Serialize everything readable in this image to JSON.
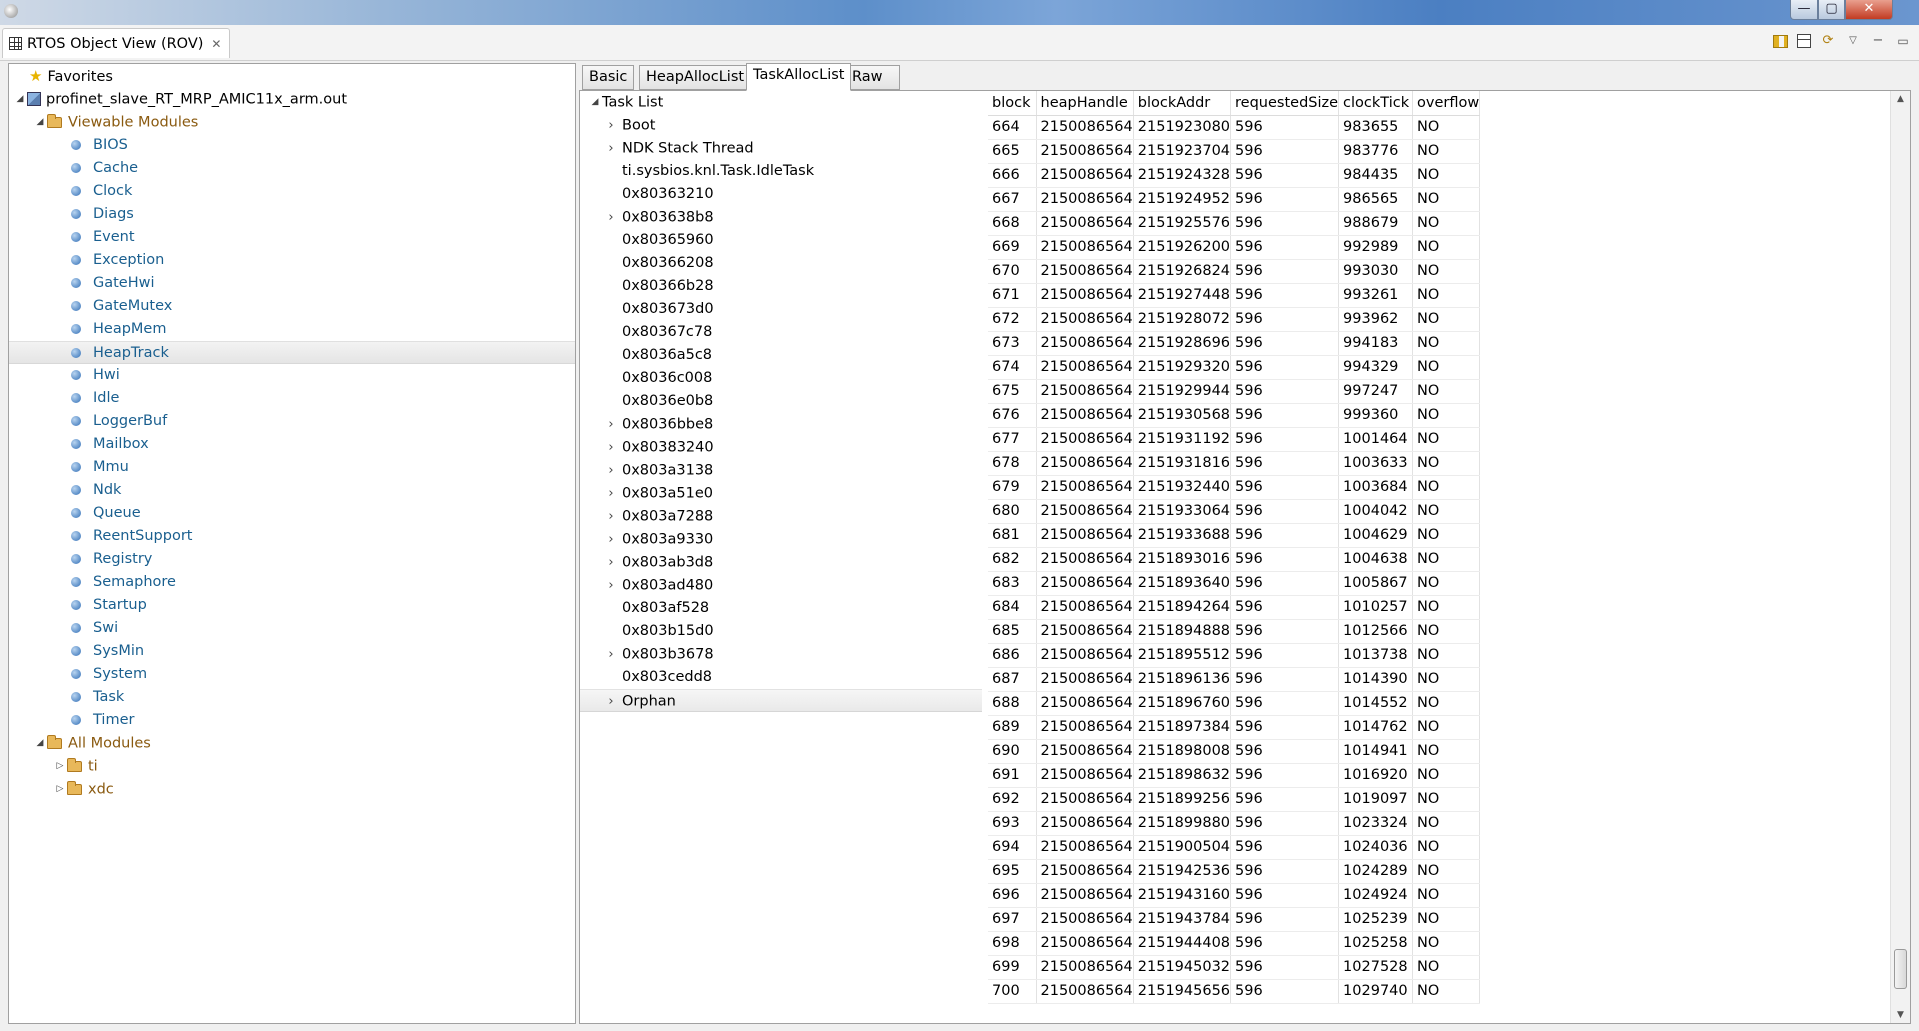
{
  "view": {
    "title": "RTOS Object View (ROV)",
    "close_glyph": "✕"
  },
  "window_buttons": {
    "minimize": "—",
    "maximize": "▢",
    "close": "✕"
  },
  "module_tree": {
    "favorites": "Favorites",
    "root": "profinet_slave_RT_MRP_AMIC11x_arm.out",
    "viewable_label": "Viewable Modules",
    "viewable": [
      "BIOS",
      "Cache",
      "Clock",
      "Diags",
      "Event",
      "Exception",
      "GateHwi",
      "GateMutex",
      "HeapMem",
      "HeapTrack",
      "Hwi",
      "Idle",
      "LoggerBuf",
      "Mailbox",
      "Mmu",
      "Ndk",
      "Queue",
      "ReentSupport",
      "Registry",
      "Semaphore",
      "Startup",
      "Swi",
      "SysMin",
      "System",
      "Task",
      "Timer"
    ],
    "selected": "HeapTrack",
    "all_label": "All Modules",
    "all": [
      "ti",
      "xdc"
    ]
  },
  "tabs": [
    {
      "label": "Basic",
      "active": false
    },
    {
      "label": "HeapAllocList",
      "active": false
    },
    {
      "label": "TaskAllocList",
      "active": true
    },
    {
      "label": "Raw",
      "active": false
    }
  ],
  "task_tree": {
    "root": "Task List",
    "items": [
      {
        "label": "Boot",
        "expandable": true
      },
      {
        "label": "NDK Stack Thread",
        "expandable": true
      },
      {
        "label": "ti.sysbios.knl.Task.IdleTask",
        "expandable": false
      },
      {
        "label": "0x80363210",
        "expandable": false
      },
      {
        "label": "0x803638b8",
        "expandable": true
      },
      {
        "label": "0x80365960",
        "expandable": false
      },
      {
        "label": "0x80366208",
        "expandable": false
      },
      {
        "label": "0x80366b28",
        "expandable": false
      },
      {
        "label": "0x803673d0",
        "expandable": false
      },
      {
        "label": "0x80367c78",
        "expandable": false
      },
      {
        "label": "0x8036a5c8",
        "expandable": false
      },
      {
        "label": "0x8036c008",
        "expandable": false
      },
      {
        "label": "0x8036e0b8",
        "expandable": false
      },
      {
        "label": "0x8036bbe8",
        "expandable": true
      },
      {
        "label": "0x80383240",
        "expandable": true
      },
      {
        "label": "0x803a3138",
        "expandable": true
      },
      {
        "label": "0x803a51e0",
        "expandable": true
      },
      {
        "label": "0x803a7288",
        "expandable": true
      },
      {
        "label": "0x803a9330",
        "expandable": true
      },
      {
        "label": "0x803ab3d8",
        "expandable": true
      },
      {
        "label": "0x803ad480",
        "expandable": true
      },
      {
        "label": "0x803af528",
        "expandable": false
      },
      {
        "label": "0x803b15d0",
        "expandable": false
      },
      {
        "label": "0x803b3678",
        "expandable": true
      },
      {
        "label": "0x803cedd8",
        "expandable": false
      },
      {
        "label": "Orphan",
        "expandable": true
      }
    ]
  },
  "alloc_table": {
    "columns": [
      "block",
      "heapHandle",
      "blockAddr",
      "requestedSize",
      "clockTick",
      "overflow"
    ],
    "rows": [
      [
        "664",
        "2150086564",
        "2151923080",
        "596",
        "983655",
        "NO"
      ],
      [
        "665",
        "2150086564",
        "2151923704",
        "596",
        "983776",
        "NO"
      ],
      [
        "666",
        "2150086564",
        "2151924328",
        "596",
        "984435",
        "NO"
      ],
      [
        "667",
        "2150086564",
        "2151924952",
        "596",
        "986565",
        "NO"
      ],
      [
        "668",
        "2150086564",
        "2151925576",
        "596",
        "988679",
        "NO"
      ],
      [
        "669",
        "2150086564",
        "2151926200",
        "596",
        "992989",
        "NO"
      ],
      [
        "670",
        "2150086564",
        "2151926824",
        "596",
        "993030",
        "NO"
      ],
      [
        "671",
        "2150086564",
        "2151927448",
        "596",
        "993261",
        "NO"
      ],
      [
        "672",
        "2150086564",
        "2151928072",
        "596",
        "993962",
        "NO"
      ],
      [
        "673",
        "2150086564",
        "2151928696",
        "596",
        "994183",
        "NO"
      ],
      [
        "674",
        "2150086564",
        "2151929320",
        "596",
        "994329",
        "NO"
      ],
      [
        "675",
        "2150086564",
        "2151929944",
        "596",
        "997247",
        "NO"
      ],
      [
        "676",
        "2150086564",
        "2151930568",
        "596",
        "999360",
        "NO"
      ],
      [
        "677",
        "2150086564",
        "2151931192",
        "596",
        "1001464",
        "NO"
      ],
      [
        "678",
        "2150086564",
        "2151931816",
        "596",
        "1003633",
        "NO"
      ],
      [
        "679",
        "2150086564",
        "2151932440",
        "596",
        "1003684",
        "NO"
      ],
      [
        "680",
        "2150086564",
        "2151933064",
        "596",
        "1004042",
        "NO"
      ],
      [
        "681",
        "2150086564",
        "2151933688",
        "596",
        "1004629",
        "NO"
      ],
      [
        "682",
        "2150086564",
        "2151893016",
        "596",
        "1004638",
        "NO"
      ],
      [
        "683",
        "2150086564",
        "2151893640",
        "596",
        "1005867",
        "NO"
      ],
      [
        "684",
        "2150086564",
        "2151894264",
        "596",
        "1010257",
        "NO"
      ],
      [
        "685",
        "2150086564",
        "2151894888",
        "596",
        "1012566",
        "NO"
      ],
      [
        "686",
        "2150086564",
        "2151895512",
        "596",
        "1013738",
        "NO"
      ],
      [
        "687",
        "2150086564",
        "2151896136",
        "596",
        "1014390",
        "NO"
      ],
      [
        "688",
        "2150086564",
        "2151896760",
        "596",
        "1014552",
        "NO"
      ],
      [
        "689",
        "2150086564",
        "2151897384",
        "596",
        "1014762",
        "NO"
      ],
      [
        "690",
        "2150086564",
        "2151898008",
        "596",
        "1014941",
        "NO"
      ],
      [
        "691",
        "2150086564",
        "2151898632",
        "596",
        "1016920",
        "NO"
      ],
      [
        "692",
        "2150086564",
        "2151899256",
        "596",
        "1019097",
        "NO"
      ],
      [
        "693",
        "2150086564",
        "2151899880",
        "596",
        "1023324",
        "NO"
      ],
      [
        "694",
        "2150086564",
        "2151900504",
        "596",
        "1024036",
        "NO"
      ],
      [
        "695",
        "2150086564",
        "2151942536",
        "596",
        "1024289",
        "NO"
      ],
      [
        "696",
        "2150086564",
        "2151943160",
        "596",
        "1024924",
        "NO"
      ],
      [
        "697",
        "2150086564",
        "2151943784",
        "596",
        "1025239",
        "NO"
      ],
      [
        "698",
        "2150086564",
        "2151944408",
        "596",
        "1025258",
        "NO"
      ],
      [
        "699",
        "2150086564",
        "2151945032",
        "596",
        "1027528",
        "NO"
      ],
      [
        "700",
        "2150086564",
        "2151945656",
        "596",
        "1029740",
        "NO"
      ]
    ]
  },
  "icons": {
    "star": "star-icon",
    "app": "app-icon",
    "folder": "folder-icon",
    "module": "module-icon"
  },
  "colors": {
    "module_text": "#1a5f8f",
    "group_text": "#8a5a10",
    "selection": "#e8e8e8"
  }
}
